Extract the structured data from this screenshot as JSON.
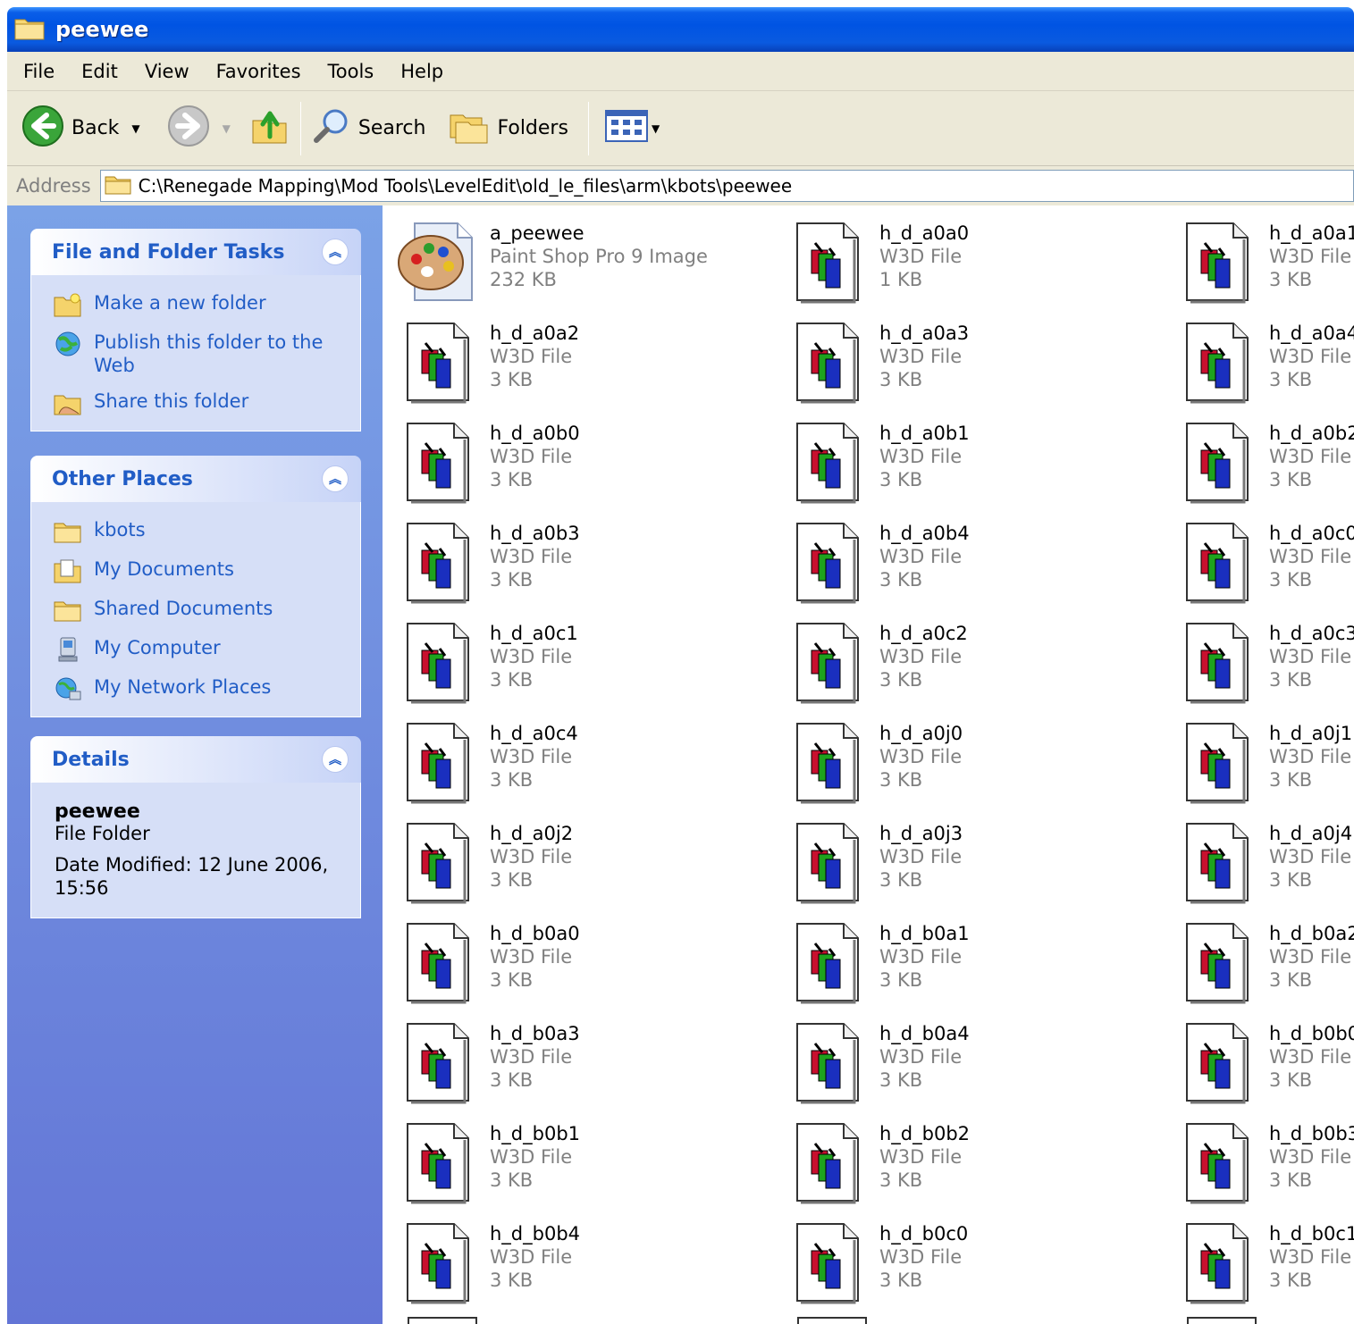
{
  "window": {
    "title": "peewee"
  },
  "menu": [
    "File",
    "Edit",
    "View",
    "Favorites",
    "Tools",
    "Help"
  ],
  "toolbar": {
    "back": "Back",
    "search": "Search",
    "folders": "Folders"
  },
  "address": {
    "label": "Address",
    "path": "C:\\Renegade Mapping\\Mod Tools\\LevelEdit\\old_le_files\\arm\\kbots\\peewee"
  },
  "tasks_panel": {
    "title": "File and Folder Tasks",
    "items": [
      "Make a new folder",
      "Publish this folder to the Web",
      "Share this folder"
    ]
  },
  "places_panel": {
    "title": "Other Places",
    "items": [
      "kbots",
      "My Documents",
      "Shared Documents",
      "My Computer",
      "My Network Places"
    ]
  },
  "details_panel": {
    "title": "Details",
    "name": "peewee",
    "type": "File Folder",
    "modified": "Date Modified: 12 June 2006, 15:56"
  },
  "files": [
    {
      "name": "a_peewee",
      "type": "Paint Shop Pro 9 Image",
      "size": "232 KB",
      "icon": "paint-palette-icon"
    },
    {
      "name": "h_d_a0a0",
      "type": "W3D File",
      "size": "1 KB",
      "icon": "w3d-file-icon"
    },
    {
      "name": "h_d_a0a1",
      "type": "W3D File",
      "size": "3 KB",
      "icon": "w3d-file-icon"
    },
    {
      "name": "h_d_a0a2",
      "type": "W3D File",
      "size": "3 KB",
      "icon": "w3d-file-icon"
    },
    {
      "name": "h_d_a0a3",
      "type": "W3D File",
      "size": "3 KB",
      "icon": "w3d-file-icon"
    },
    {
      "name": "h_d_a0a4",
      "type": "W3D File",
      "size": "3 KB",
      "icon": "w3d-file-icon"
    },
    {
      "name": "h_d_a0b0",
      "type": "W3D File",
      "size": "3 KB",
      "icon": "w3d-file-icon"
    },
    {
      "name": "h_d_a0b1",
      "type": "W3D File",
      "size": "3 KB",
      "icon": "w3d-file-icon"
    },
    {
      "name": "h_d_a0b2",
      "type": "W3D File",
      "size": "3 KB",
      "icon": "w3d-file-icon"
    },
    {
      "name": "h_d_a0b3",
      "type": "W3D File",
      "size": "3 KB",
      "icon": "w3d-file-icon"
    },
    {
      "name": "h_d_a0b4",
      "type": "W3D File",
      "size": "3 KB",
      "icon": "w3d-file-icon"
    },
    {
      "name": "h_d_a0c0",
      "type": "W3D File",
      "size": "3 KB",
      "icon": "w3d-file-icon"
    },
    {
      "name": "h_d_a0c1",
      "type": "W3D File",
      "size": "3 KB",
      "icon": "w3d-file-icon"
    },
    {
      "name": "h_d_a0c2",
      "type": "W3D File",
      "size": "3 KB",
      "icon": "w3d-file-icon"
    },
    {
      "name": "h_d_a0c3",
      "type": "W3D File",
      "size": "3 KB",
      "icon": "w3d-file-icon"
    },
    {
      "name": "h_d_a0c4",
      "type": "W3D File",
      "size": "3 KB",
      "icon": "w3d-file-icon"
    },
    {
      "name": "h_d_a0j0",
      "type": "W3D File",
      "size": "3 KB",
      "icon": "w3d-file-icon"
    },
    {
      "name": "h_d_a0j1",
      "type": "W3D File",
      "size": "3 KB",
      "icon": "w3d-file-icon"
    },
    {
      "name": "h_d_a0j2",
      "type": "W3D File",
      "size": "3 KB",
      "icon": "w3d-file-icon"
    },
    {
      "name": "h_d_a0j3",
      "type": "W3D File",
      "size": "3 KB",
      "icon": "w3d-file-icon"
    },
    {
      "name": "h_d_a0j4",
      "type": "W3D File",
      "size": "3 KB",
      "icon": "w3d-file-icon"
    },
    {
      "name": "h_d_b0a0",
      "type": "W3D File",
      "size": "3 KB",
      "icon": "w3d-file-icon"
    },
    {
      "name": "h_d_b0a1",
      "type": "W3D File",
      "size": "3 KB",
      "icon": "w3d-file-icon"
    },
    {
      "name": "h_d_b0a2",
      "type": "W3D File",
      "size": "3 KB",
      "icon": "w3d-file-icon"
    },
    {
      "name": "h_d_b0a3",
      "type": "W3D File",
      "size": "3 KB",
      "icon": "w3d-file-icon"
    },
    {
      "name": "h_d_b0a4",
      "type": "W3D File",
      "size": "3 KB",
      "icon": "w3d-file-icon"
    },
    {
      "name": "h_d_b0b0",
      "type": "W3D File",
      "size": "3 KB",
      "icon": "w3d-file-icon"
    },
    {
      "name": "h_d_b0b1",
      "type": "W3D File",
      "size": "3 KB",
      "icon": "w3d-file-icon"
    },
    {
      "name": "h_d_b0b2",
      "type": "W3D File",
      "size": "3 KB",
      "icon": "w3d-file-icon"
    },
    {
      "name": "h_d_b0b3",
      "type": "W3D File",
      "size": "3 KB",
      "icon": "w3d-file-icon"
    },
    {
      "name": "h_d_b0b4",
      "type": "W3D File",
      "size": "3 KB",
      "icon": "w3d-file-icon"
    },
    {
      "name": "h_d_b0c0",
      "type": "W3D File",
      "size": "3 KB",
      "icon": "w3d-file-icon"
    },
    {
      "name": "h_d_b0c1",
      "type": "W3D File",
      "size": "3 KB",
      "icon": "w3d-file-icon"
    }
  ]
}
